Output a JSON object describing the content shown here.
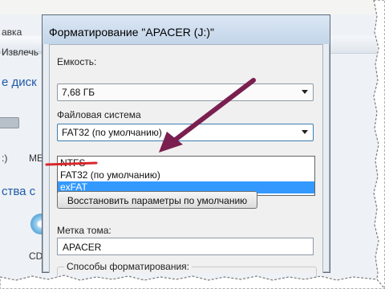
{
  "background": {
    "menu_item": "авка",
    "command": "Извлечь",
    "heading_disks": "е диск",
    "drive_letter": ":)",
    "drive_label": "МЕ",
    "heading_devices": "ства с",
    "cd_label": "CD"
  },
  "dialog": {
    "title": "Форматирование \"APACER (J:)\"",
    "capacity_label": "Емкость:",
    "capacity_value": "7,68 ГБ",
    "filesystem_label": "Файловая система",
    "filesystem_value": "FAT32 (по умолчанию)",
    "filesystem_options": [
      "NTFS",
      "FAT32 (по умолчанию)",
      "exFAT"
    ],
    "filesystem_highlighted": "exFAT",
    "restore_defaults_button": "Восстановить параметры по умолчанию",
    "volume_label_label": "Метка тома:",
    "volume_label_value": "APACER",
    "format_options_label": "Способы форматирования:"
  },
  "annotation": {
    "arrow_color": "#7a1f4f",
    "underline_color": "#d9262b"
  }
}
